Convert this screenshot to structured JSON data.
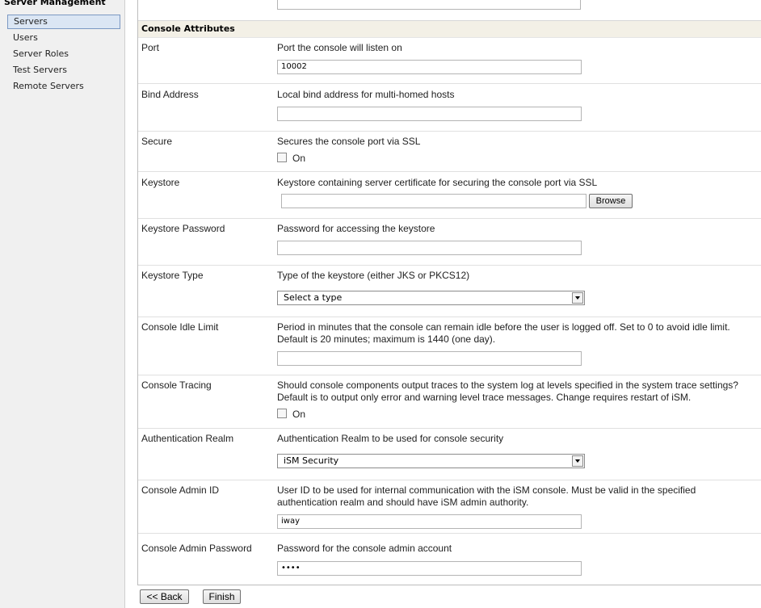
{
  "sidebar": {
    "title": "Server Management",
    "items": [
      {
        "label": "Servers",
        "selected": true
      },
      {
        "label": "Users",
        "selected": false
      },
      {
        "label": "Server Roles",
        "selected": false
      },
      {
        "label": "Test Servers",
        "selected": false
      },
      {
        "label": "Remote Servers",
        "selected": false
      }
    ]
  },
  "section": {
    "title": "Console Attributes"
  },
  "fields": {
    "port": {
      "label": "Port",
      "description": "Port the console will listen on",
      "value": "10002"
    },
    "bind_address": {
      "label": "Bind Address",
      "description": "Local bind address for multi-homed hosts",
      "value": ""
    },
    "secure": {
      "label": "Secure",
      "description": "Secures the console port via SSL",
      "checkbox_label": "On",
      "checked": false
    },
    "keystore": {
      "label": "Keystore",
      "description": "Keystore containing server certificate for securing the console port via SSL",
      "value": "",
      "browse_label": "Browse"
    },
    "keystore_password": {
      "label": "Keystore Password",
      "description": "Password for accessing the keystore",
      "value": ""
    },
    "keystore_type": {
      "label": "Keystore Type",
      "description": "Type of the keystore (either JKS or PKCS12)",
      "selected": "Select a type"
    },
    "idle_limit": {
      "label": "Console Idle Limit",
      "description": "Period in minutes that the console can remain idle before the user is logged off. Set to 0 to avoid idle limit. Default is 20 minutes; maximum is 1440 (one day).",
      "value": ""
    },
    "tracing": {
      "label": "Console Tracing",
      "description": "Should console components output traces to the system log at levels specified in the system trace settings? Default is to output only error and warning level trace messages. Change requires restart of iSM.",
      "checkbox_label": "On",
      "checked": false
    },
    "auth_realm": {
      "label": "Authentication Realm",
      "description": "Authentication Realm to be used for console security",
      "selected": "iSM Security"
    },
    "admin_id": {
      "label": "Console Admin ID",
      "description": "User ID to be used for internal communication with the iSM console. Must be valid in the specified authentication realm and should have iSM admin authority.",
      "value": "iway"
    },
    "admin_password": {
      "label": "Console Admin Password",
      "description": "Password for the console admin account",
      "value": "••••"
    }
  },
  "buttons": {
    "back": "<< Back",
    "finish": "Finish"
  }
}
